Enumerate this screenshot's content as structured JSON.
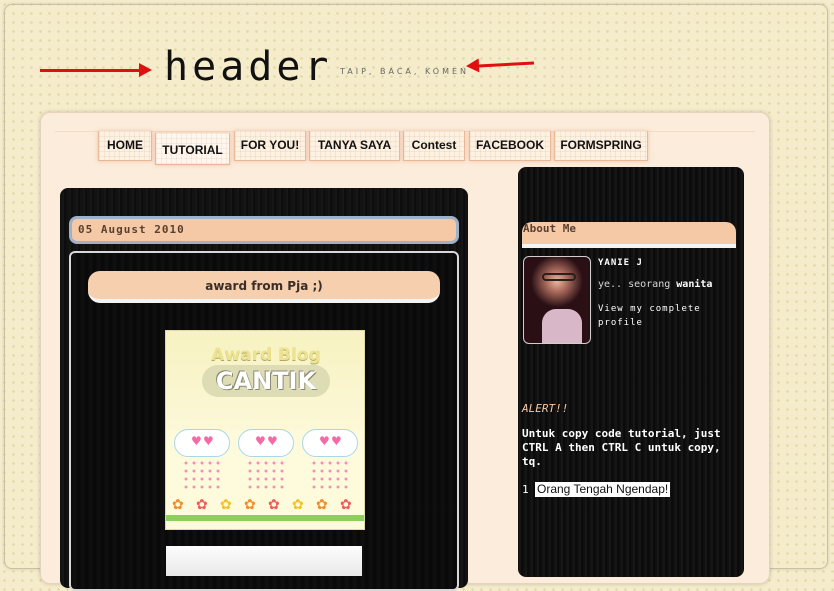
{
  "header": {
    "title": "header",
    "tagline": "TAIP, BACA, KOMEN"
  },
  "nav": {
    "tabs": [
      {
        "label": "HOME",
        "active": false
      },
      {
        "label": "TUTORIAL",
        "active": true
      },
      {
        "label": "FOR YOU!",
        "active": false
      },
      {
        "label": "TANYA SAYA",
        "active": false
      },
      {
        "label": "Contest",
        "active": false
      },
      {
        "label": "FACEBOOK",
        "active": false
      },
      {
        "label": "FORMSPRING",
        "active": false
      }
    ]
  },
  "post": {
    "date": "05 August 2010",
    "title": "award from Pja ;)",
    "image": {
      "line1": "Award Blog",
      "line2": "CANTIK"
    }
  },
  "sidebar": {
    "about_title": "About Me",
    "profile_name": "YANIE J",
    "profile_desc_prefix": "ye.. seorang",
    "profile_desc_bold": "wanita",
    "profile_link": "View my complete profile",
    "alert": "ALERT!!",
    "copy_instructions": "Untuk copy code tutorial, just CTRL A then CTRL C untuk copy, tq.",
    "online_count": "1",
    "online_label": "Orang Tengah Ngendap!"
  },
  "colors": {
    "accent_peach": "#f6c9a6",
    "background_cream": "#f4eccb",
    "arrow_red": "#e01010"
  }
}
